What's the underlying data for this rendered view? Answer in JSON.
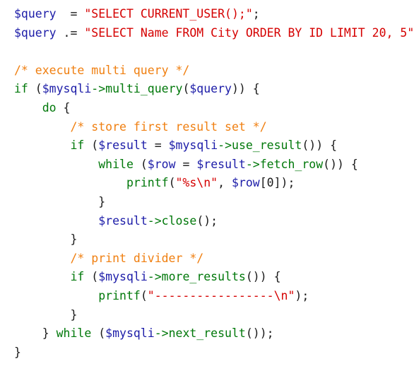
{
  "code": {
    "language": "php",
    "colors": {
      "variable": "#1c1ca8",
      "string": "#d50000",
      "comment": "#f07f10",
      "keyword": "#00780a",
      "plain": "#1a1a1a"
    },
    "lines": [
      {
        "tokens": [
          {
            "t": "variable",
            "v": "$query"
          },
          {
            "t": "plain",
            "v": "  = "
          },
          {
            "t": "string",
            "v": "\"SELECT CURRENT_USER();\""
          },
          {
            "t": "plain",
            "v": ";"
          }
        ]
      },
      {
        "tokens": [
          {
            "t": "variable",
            "v": "$query"
          },
          {
            "t": "plain",
            "v": " .= "
          },
          {
            "t": "string",
            "v": "\"SELECT Name FROM City ORDER BY ID LIMIT 20, 5\""
          },
          {
            "t": "plain",
            "v": ";"
          }
        ]
      },
      {
        "tokens": []
      },
      {
        "tokens": [
          {
            "t": "comment",
            "v": "/* execute multi query */"
          }
        ]
      },
      {
        "tokens": [
          {
            "t": "keyword",
            "v": "if"
          },
          {
            "t": "plain",
            "v": " ("
          },
          {
            "t": "variable",
            "v": "$mysqli"
          },
          {
            "t": "keyword",
            "v": "->multi_query"
          },
          {
            "t": "plain",
            "v": "("
          },
          {
            "t": "variable",
            "v": "$query"
          },
          {
            "t": "plain",
            "v": ")) {"
          }
        ]
      },
      {
        "tokens": [
          {
            "t": "plain",
            "v": "    "
          },
          {
            "t": "keyword",
            "v": "do"
          },
          {
            "t": "plain",
            "v": " {"
          }
        ]
      },
      {
        "tokens": [
          {
            "t": "plain",
            "v": "        "
          },
          {
            "t": "comment",
            "v": "/* store first result set */"
          }
        ]
      },
      {
        "tokens": [
          {
            "t": "plain",
            "v": "        "
          },
          {
            "t": "keyword",
            "v": "if"
          },
          {
            "t": "plain",
            "v": " ("
          },
          {
            "t": "variable",
            "v": "$result"
          },
          {
            "t": "plain",
            "v": " = "
          },
          {
            "t": "variable",
            "v": "$mysqli"
          },
          {
            "t": "keyword",
            "v": "->use_result"
          },
          {
            "t": "plain",
            "v": "()) {"
          }
        ]
      },
      {
        "tokens": [
          {
            "t": "plain",
            "v": "            "
          },
          {
            "t": "keyword",
            "v": "while"
          },
          {
            "t": "plain",
            "v": " ("
          },
          {
            "t": "variable",
            "v": "$row"
          },
          {
            "t": "plain",
            "v": " = "
          },
          {
            "t": "variable",
            "v": "$result"
          },
          {
            "t": "keyword",
            "v": "->fetch_row"
          },
          {
            "t": "plain",
            "v": "()) {"
          }
        ]
      },
      {
        "tokens": [
          {
            "t": "plain",
            "v": "                "
          },
          {
            "t": "keyword",
            "v": "printf"
          },
          {
            "t": "plain",
            "v": "("
          },
          {
            "t": "string",
            "v": "\"%s\\n\""
          },
          {
            "t": "plain",
            "v": ", "
          },
          {
            "t": "variable",
            "v": "$row"
          },
          {
            "t": "plain",
            "v": "[0]);"
          }
        ]
      },
      {
        "tokens": [
          {
            "t": "plain",
            "v": "            }"
          }
        ]
      },
      {
        "tokens": [
          {
            "t": "plain",
            "v": "            "
          },
          {
            "t": "variable",
            "v": "$result"
          },
          {
            "t": "keyword",
            "v": "->close"
          },
          {
            "t": "plain",
            "v": "();"
          }
        ]
      },
      {
        "tokens": [
          {
            "t": "plain",
            "v": "        }"
          }
        ]
      },
      {
        "tokens": [
          {
            "t": "plain",
            "v": "        "
          },
          {
            "t": "comment",
            "v": "/* print divider */"
          }
        ]
      },
      {
        "tokens": [
          {
            "t": "plain",
            "v": "        "
          },
          {
            "t": "keyword",
            "v": "if"
          },
          {
            "t": "plain",
            "v": " ("
          },
          {
            "t": "variable",
            "v": "$mysqli"
          },
          {
            "t": "keyword",
            "v": "->more_results"
          },
          {
            "t": "plain",
            "v": "()) {"
          }
        ]
      },
      {
        "tokens": [
          {
            "t": "plain",
            "v": "            "
          },
          {
            "t": "keyword",
            "v": "printf"
          },
          {
            "t": "plain",
            "v": "("
          },
          {
            "t": "string",
            "v": "\"-----------------\\n\""
          },
          {
            "t": "plain",
            "v": ");"
          }
        ]
      },
      {
        "tokens": [
          {
            "t": "plain",
            "v": "        }"
          }
        ]
      },
      {
        "tokens": [
          {
            "t": "plain",
            "v": "    } "
          },
          {
            "t": "keyword",
            "v": "while"
          },
          {
            "t": "plain",
            "v": " ("
          },
          {
            "t": "variable",
            "v": "$mysqli"
          },
          {
            "t": "keyword",
            "v": "->next_result"
          },
          {
            "t": "plain",
            "v": "());"
          }
        ]
      },
      {
        "tokens": [
          {
            "t": "plain",
            "v": "}"
          }
        ]
      }
    ]
  }
}
